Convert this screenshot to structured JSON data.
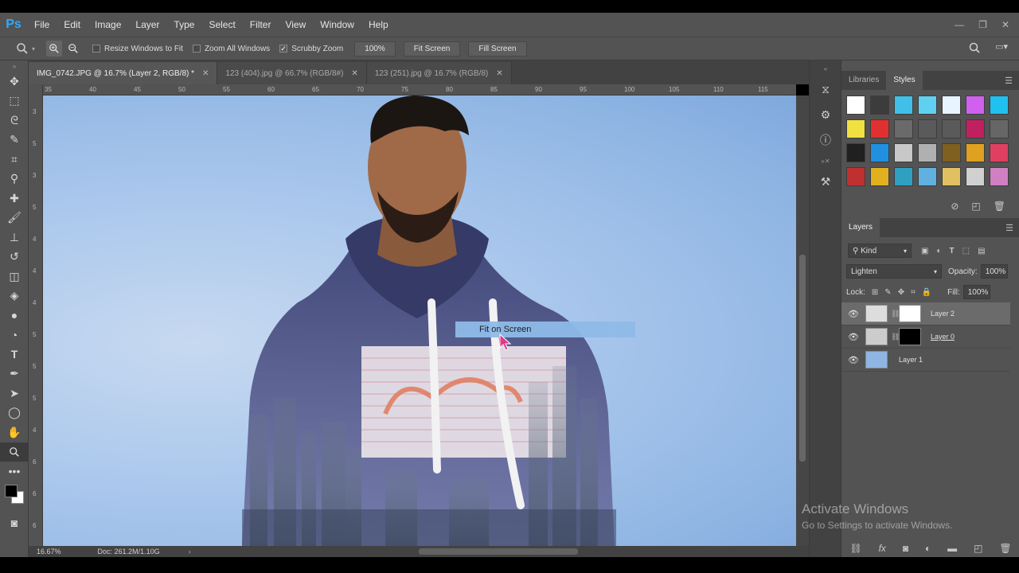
{
  "app": {
    "logo": "Ps"
  },
  "menu": [
    "File",
    "Edit",
    "Image",
    "Layer",
    "Type",
    "Select",
    "Filter",
    "View",
    "Window",
    "Help"
  ],
  "options": {
    "resize_windows": "Resize Windows to Fit",
    "zoom_all": "Zoom All Windows",
    "scrubby_zoom": "Scrubby Zoom",
    "zoom_value": "100%",
    "fit_screen": "Fit Screen",
    "fill_screen": "Fill Screen"
  },
  "tabs": [
    {
      "label": "IMG_0742.JPG @ 16.7% (Layer 2, RGB/8) *",
      "active": true
    },
    {
      "label": "123 (404).jpg @ 66.7% (RGB/8#)",
      "active": false
    },
    {
      "label": "123 (251).jpg @ 16.7% (RGB/8)",
      "active": false
    }
  ],
  "ruler": {
    "h": [
      "35",
      "40",
      "45",
      "50",
      "55",
      "60",
      "65",
      "70",
      "75",
      "80",
      "85",
      "90",
      "95",
      "100",
      "105",
      "110",
      "115"
    ],
    "v": [
      "3",
      "5",
      "3",
      "5",
      "4",
      "4",
      "4",
      "5",
      "5",
      "5",
      "4",
      "6",
      "6",
      "6"
    ]
  },
  "tooltip": "Fit on Screen",
  "status": {
    "zoom": "16.67%",
    "doc": "Doc: 261.2M/1.10G"
  },
  "panels": {
    "top_tabs": [
      "Libraries",
      "Styles"
    ],
    "layers_tab": "Layers",
    "kind": "Kind",
    "blend_mode": "Lighten",
    "opacity_label": "Opacity:",
    "opacity": "100%",
    "lock_label": "Lock:",
    "fill_label": "Fill:",
    "fill": "100%",
    "layers": [
      {
        "name": "Layer 2",
        "selected": true
      },
      {
        "name": "Layer 0",
        "selected": false
      },
      {
        "name": "Layer 1",
        "selected": false
      }
    ]
  },
  "style_colors": [
    "#ffffff",
    "#3c3c3c",
    "#40c0e8",
    "#60d0f0",
    "#e8f4ff",
    "#d060f0",
    "#20c0f0",
    "#f0e040",
    "#e03030",
    "#6a6a6a",
    "#5a5a5a",
    "#5a5a5a",
    "#c02060",
    "#666666",
    "#202020",
    "#2090e0",
    "#c8c8c8",
    "#b0b0b0",
    "#806020",
    "#e0a020",
    "#e04060",
    "#c03030",
    "#e0b020",
    "#30a0c0",
    "#60b0e0",
    "#e0c060",
    "#d0d0d0",
    "#d080c0"
  ],
  "watermark": {
    "title": "Activate Windows",
    "subtitle": "Go to Settings to activate Windows."
  }
}
